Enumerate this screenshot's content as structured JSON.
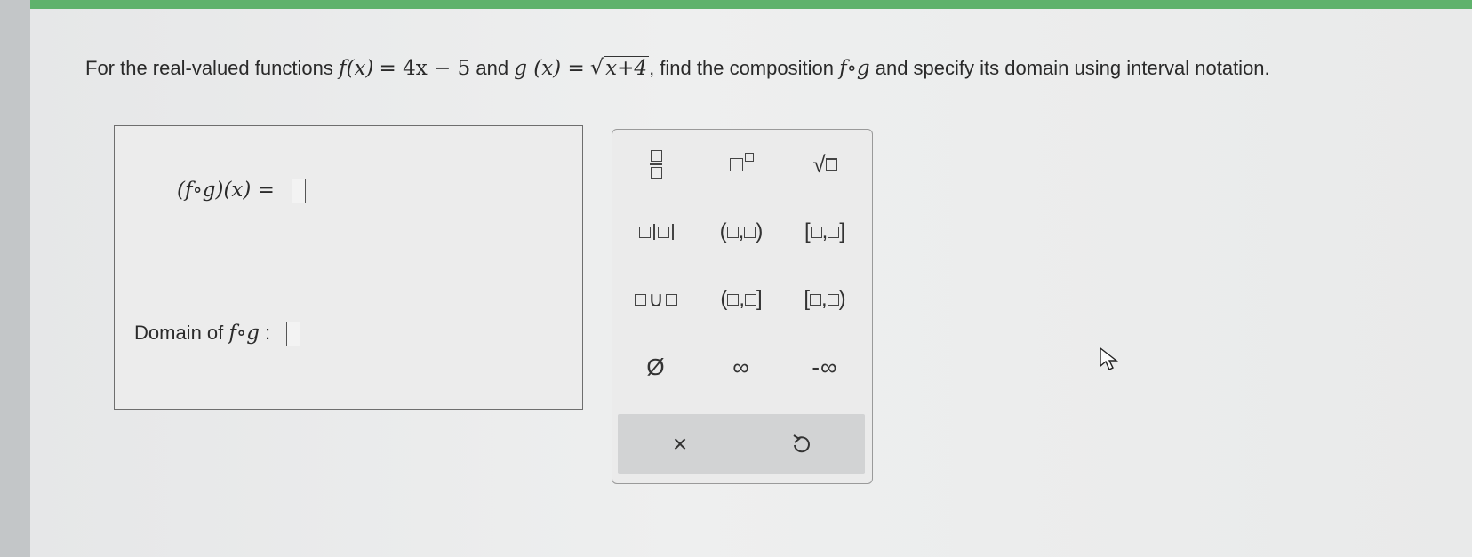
{
  "question": {
    "intro": "For the real-valued functions",
    "f_lhs": "f(x)",
    "f_rhs": "= 4x − 5",
    "and": "and",
    "g_lhs": "g (x) =",
    "g_radicand": "x+4",
    "find": ", find the composition",
    "comp": "f∘g",
    "tail": "and specify its domain using interval notation."
  },
  "answer": {
    "expr_label": "(f∘g)(x) =",
    "domain_label": "Domain of",
    "domain_comp": "f∘g",
    "domain_colon": ":"
  },
  "palette": {
    "union": "∪",
    "empty_set": "Ø",
    "infinity": "∞",
    "neg_infinity": "-∞",
    "clear": "×",
    "undo_icon": "undo-icon"
  }
}
